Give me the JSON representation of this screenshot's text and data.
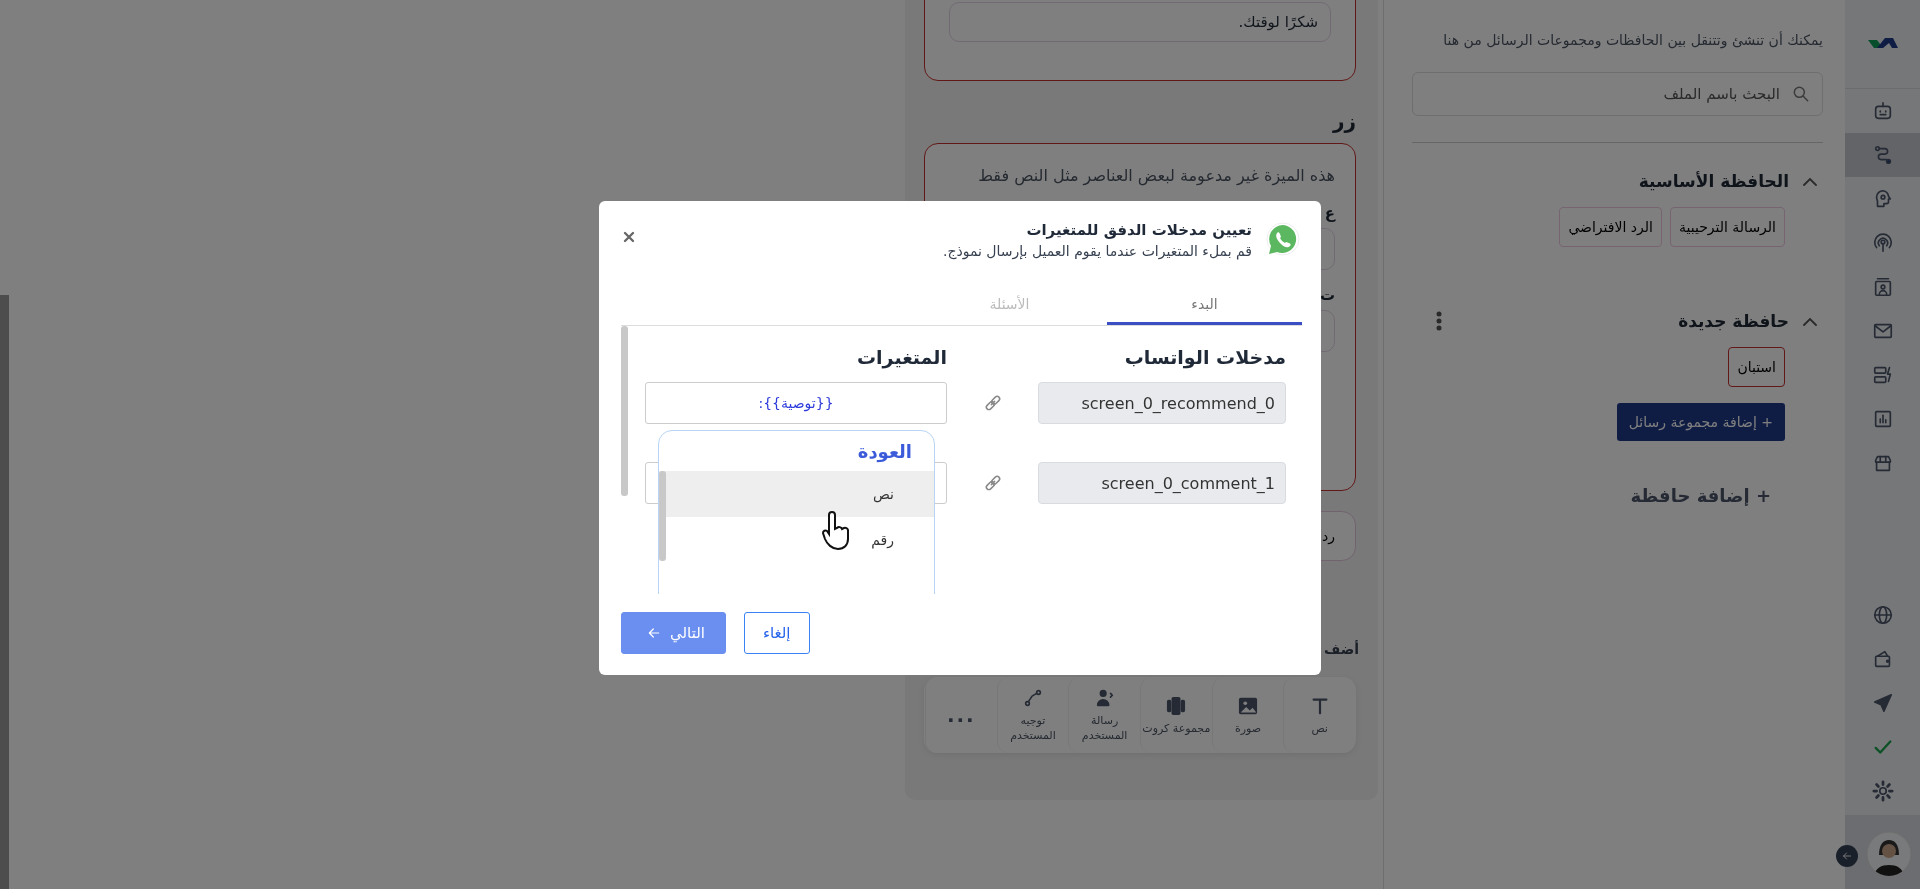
{
  "editor_panel": {
    "message_field": {
      "value": "شكرًا لوقتك."
    },
    "button_heading": "زر",
    "button_note": "هذه الميزة غير مدعومة لبعض العناصر مثل النص فقط",
    "field_labels": [
      "ع",
      "ت"
    ],
    "reply_button": "رد",
    "add_heading": "أضف",
    "tools": [
      {
        "label": "نص",
        "kind": "tool"
      },
      {
        "label": "صورة",
        "kind": "tool"
      },
      {
        "label": "مجموعة كروت",
        "kind": "tool"
      },
      {
        "label": "رسالة المستخدم",
        "kind": "tool"
      },
      {
        "label": "توجيه المستخدم",
        "kind": "tool"
      },
      {
        "label": "...",
        "kind": "more"
      }
    ]
  },
  "sidebar": {
    "hint": "يمكنك أن تنشئ وتتنقل بين الحافظات ومجموعات الرسائل من هنا",
    "search": {
      "placeholder": "البحث باسم الملف"
    },
    "folders": [
      {
        "title": "الحافظة الأساسية",
        "expanded": true,
        "menu": false,
        "groups": [
          {
            "label": "الرسالة الترحيبية",
            "selected": false
          },
          {
            "label": "الرد الافتراضي",
            "selected": false
          }
        ]
      },
      {
        "title": "حافظة جديدة",
        "expanded": true,
        "menu": true,
        "groups": [
          {
            "label": "استبان",
            "selected": true
          }
        ],
        "add_group": "+ إضافة مجموعة رسائل"
      }
    ],
    "add_folder": "+ إضافة حافظة"
  },
  "rail": {
    "items": [
      {
        "selected": false
      },
      {
        "selected": true
      },
      {
        "selected": false
      },
      {
        "selected": false
      },
      {
        "selected": false
      },
      {
        "selected": false
      },
      {
        "selected": false
      },
      {
        "selected": false
      },
      {
        "selected": false
      }
    ]
  },
  "dialog": {
    "title": "تعيين مدخلات الدفق للمتغيرات",
    "subtitle": "قم بملء المتغيرات عندما يقوم العميل بإرسال نموذج.",
    "tabs": [
      {
        "label": "البدء",
        "selected": true
      },
      {
        "label": "الأسئلة",
        "selected": false
      }
    ],
    "columns": [
      "مدخلات الواتساب",
      "المتغيرات"
    ],
    "rows": [
      {
        "input": "screen_0_recommend_0",
        "variable": "{{توصية}}:"
      },
      {
        "input": "screen_0_comment_1"
      }
    ],
    "dropdown": {
      "back": "العودة",
      "options": [
        {
          "label": "نص",
          "selected": true
        },
        {
          "label": "رقم",
          "selected": false
        }
      ]
    },
    "buttons": [
      {
        "label": "إلغاء",
        "kind": "outline"
      },
      {
        "label": "التالي",
        "kind": "primary",
        "disabled": true
      }
    ]
  }
}
